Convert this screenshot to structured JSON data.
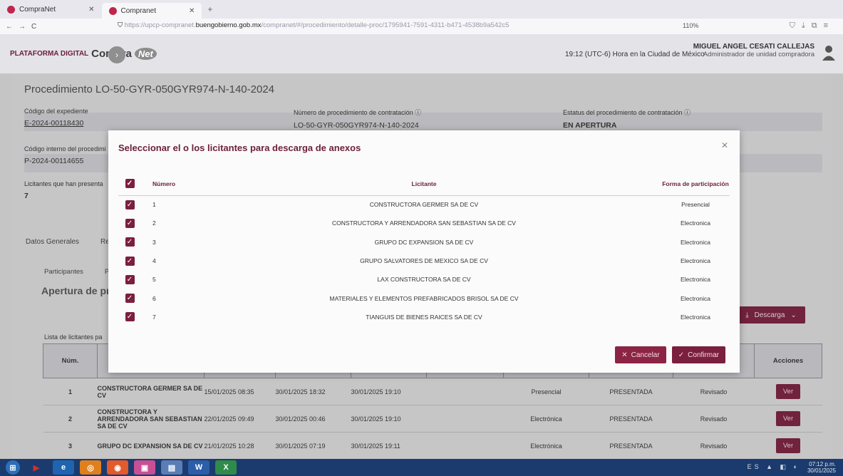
{
  "browser": {
    "tabs": [
      {
        "label": "CompraNet",
        "active": false
      },
      {
        "label": "Compranet",
        "active": true
      }
    ],
    "url_dim_prefix": "https://upcp-compranet.",
    "url_domain": "buengobierno.gob.mx",
    "url_dim_suffix": "/compranet/#/procedimiento/detalle-proc/1795941-7591-4311-b471-4538b9a542c5",
    "zoom": "110%"
  },
  "header": {
    "logo_prefix": "PLATAFORMA DIGITAL",
    "logo_main": "Compra",
    "logo_net": "Net",
    "clock": "19:12 (UTC-6) Hora en la Ciudad de México",
    "user_name": "MIGUEL ANGEL CESATI CALLEJAS",
    "user_role": "Administrador de unidad compradora"
  },
  "page": {
    "title": "Procedimiento LO-50-GYR-050GYR974-N-140-2024",
    "fields": {
      "codigo_expediente_label": "Código del expediente",
      "codigo_expediente_value": "E-2024-00118430",
      "numero_proc_label": "Número de procedimiento de contratación ⓘ",
      "numero_proc_value": "LO-50-GYR-050GYR974-N-140-2024",
      "estatus_label": "Estatus del procedimiento de contratación ⓘ",
      "estatus_value": "EN APERTURA",
      "codigo_interno_label": "Código interno del procedimi",
      "codigo_interno_value": "P-2024-00114655",
      "licitantes_label": "Licitantes que han presenta",
      "licitantes_value": "7"
    },
    "tabs": [
      "Datos Generales",
      "Re"
    ],
    "subtabs": [
      "Participantes",
      "Pr"
    ],
    "section_title": "Apertura de pro",
    "descarga_label": "Descarga",
    "list_label": "Lista de licitantes pa",
    "table": {
      "headers": [
        "Núm.",
        "",
        "",
        "",
        "",
        "",
        "",
        "",
        "",
        "Acciones"
      ],
      "rows": [
        {
          "num": "1",
          "name": "CONSTRUCTORA GERMER SA DE CV",
          "d1": "15/01/2025 08:35",
          "d2": "30/01/2025 18:32",
          "d3": "30/01/2025 19:10",
          "forma": "Presencial",
          "estado": "PRESENTADA",
          "rev": "Revisado",
          "accion": "Ver"
        },
        {
          "num": "2",
          "name": "CONSTRUCTORA Y ARRENDADORA SAN SEBASTIAN SA DE CV",
          "d1": "22/01/2025 09:49",
          "d2": "30/01/2025 00:46",
          "d3": "30/01/2025 19:10",
          "forma": "Electrónica",
          "estado": "PRESENTADA",
          "rev": "Revisado",
          "accion": "Ver"
        },
        {
          "num": "3",
          "name": "GRUPO DC EXPANSION SA DE CV",
          "d1": "21/01/2025 10:28",
          "d2": "30/01/2025 07:19",
          "d3": "30/01/2025 19:11",
          "forma": "Electrónica",
          "estado": "PRESENTADA",
          "rev": "Revisado",
          "accion": "Ver"
        }
      ]
    }
  },
  "modal": {
    "title": "Seleccionar el o los licitantes para descarga de anexos",
    "headers": {
      "numero": "Número",
      "licitante": "Licitante",
      "forma": "Forma de participación"
    },
    "rows": [
      {
        "numero": "1",
        "licitante": "CONSTRUCTORA GERMER SA DE CV",
        "forma": "Presencial",
        "checked": true
      },
      {
        "numero": "2",
        "licitante": "CONSTRUCTORA Y ARRENDADORA SAN SEBASTIAN SA DE CV",
        "forma": "Electronica",
        "checked": true
      },
      {
        "numero": "3",
        "licitante": "GRUPO DC EXPANSION SA DE CV",
        "forma": "Electronica",
        "checked": true
      },
      {
        "numero": "4",
        "licitante": "GRUPO SALVATORES DE MEXICO SA DE CV",
        "forma": "Electronica",
        "checked": true
      },
      {
        "numero": "5",
        "licitante": "LAX CONSTRUCTORA SA DE CV",
        "forma": "Electronica",
        "checked": true
      },
      {
        "numero": "6",
        "licitante": "MATERIALES Y ELEMENTOS PREFABRICADOS BRISOL SA DE CV",
        "forma": "Electronica",
        "checked": true
      },
      {
        "numero": "7",
        "licitante": "TIANGUIS DE BIENES RAICES SA DE CV",
        "forma": "Electronica",
        "checked": true
      }
    ],
    "cancel_label": "Cancelar",
    "confirm_label": "Confirmar"
  },
  "taskbar": {
    "time": "07:12 p.m.",
    "date": "30/01/2025"
  },
  "colors": {
    "primary": "#7b1f3e",
    "title": "#6b1f3a"
  }
}
